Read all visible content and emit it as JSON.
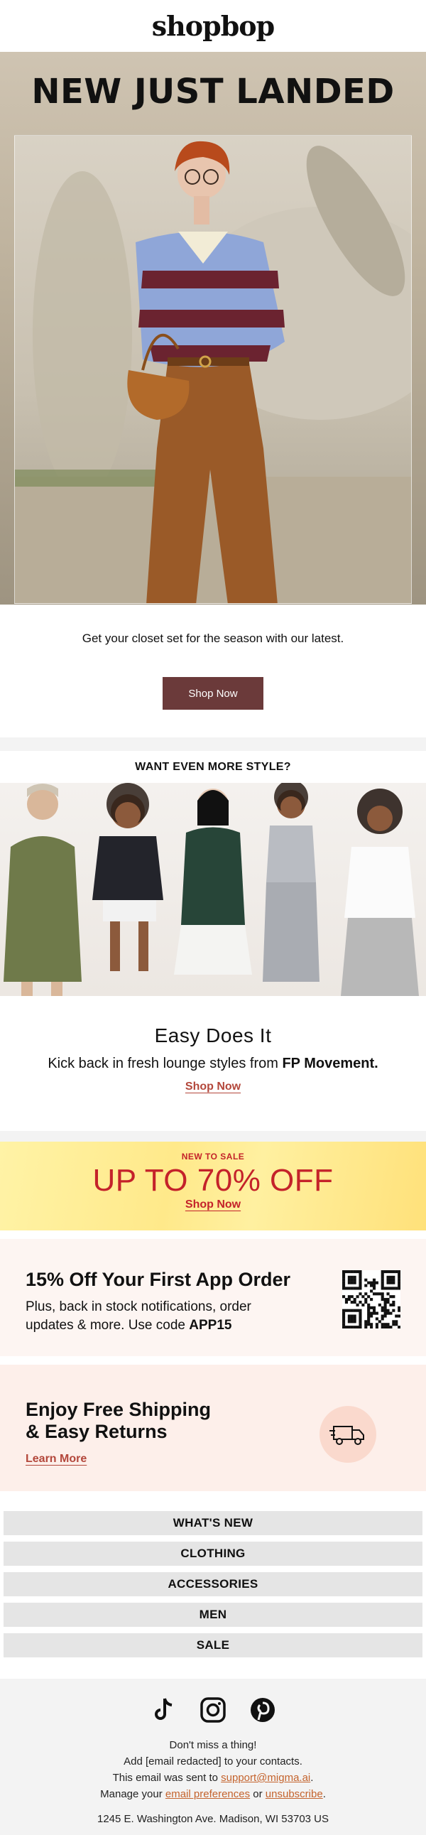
{
  "brand": {
    "logo": "shopbop"
  },
  "hero": {
    "title": "NEW JUST LANDED",
    "subtitle": "Get your closet set for the season with our latest.",
    "cta": "Shop Now"
  },
  "style_section": {
    "heading": "WANT EVEN MORE STYLE?",
    "title": "Easy Does It",
    "desc_prefix": "Kick back in fresh lounge styles from ",
    "desc_brand": "FP Movement.",
    "cta": "Shop Now"
  },
  "sale": {
    "eyebrow": "NEW TO SALE",
    "headline": "UP TO 70% OFF",
    "cta": "Shop Now"
  },
  "app_promo": {
    "title": "15% Off Your First App Order",
    "desc_prefix": "Plus, back in stock notifications, order updates & more. Use code ",
    "code": "APP15"
  },
  "shipping": {
    "line1": "Enjoy Free Shipping",
    "line2": "& Easy Returns",
    "cta": "Learn More"
  },
  "nav": {
    "items": [
      "WHAT'S NEW",
      "CLOTHING",
      "ACCESSORIES",
      "MEN",
      "SALE"
    ]
  },
  "footer": {
    "social_icons": [
      "tiktok-icon",
      "instagram-icon",
      "pinterest-icon"
    ],
    "line1": "Don't miss a thing!",
    "line2": "Add [email redacted] to your contacts.",
    "line3_prefix": "This email was sent to ",
    "line3_email": "support@migma.ai",
    "line3_suffix": ".",
    "line4_prefix": "Manage your ",
    "line4_link1": "email preferences",
    "line4_mid": " or ",
    "line4_link2": "unsubscribe",
    "line4_suffix": ".",
    "address": "1245 E. Washington Ave. Madison, WI 53703 US"
  },
  "colors": {
    "button_bg": "#6b3a3a",
    "link": "#b3473b",
    "sale_red": "#c4222a",
    "footer_link": "#c4632d"
  }
}
